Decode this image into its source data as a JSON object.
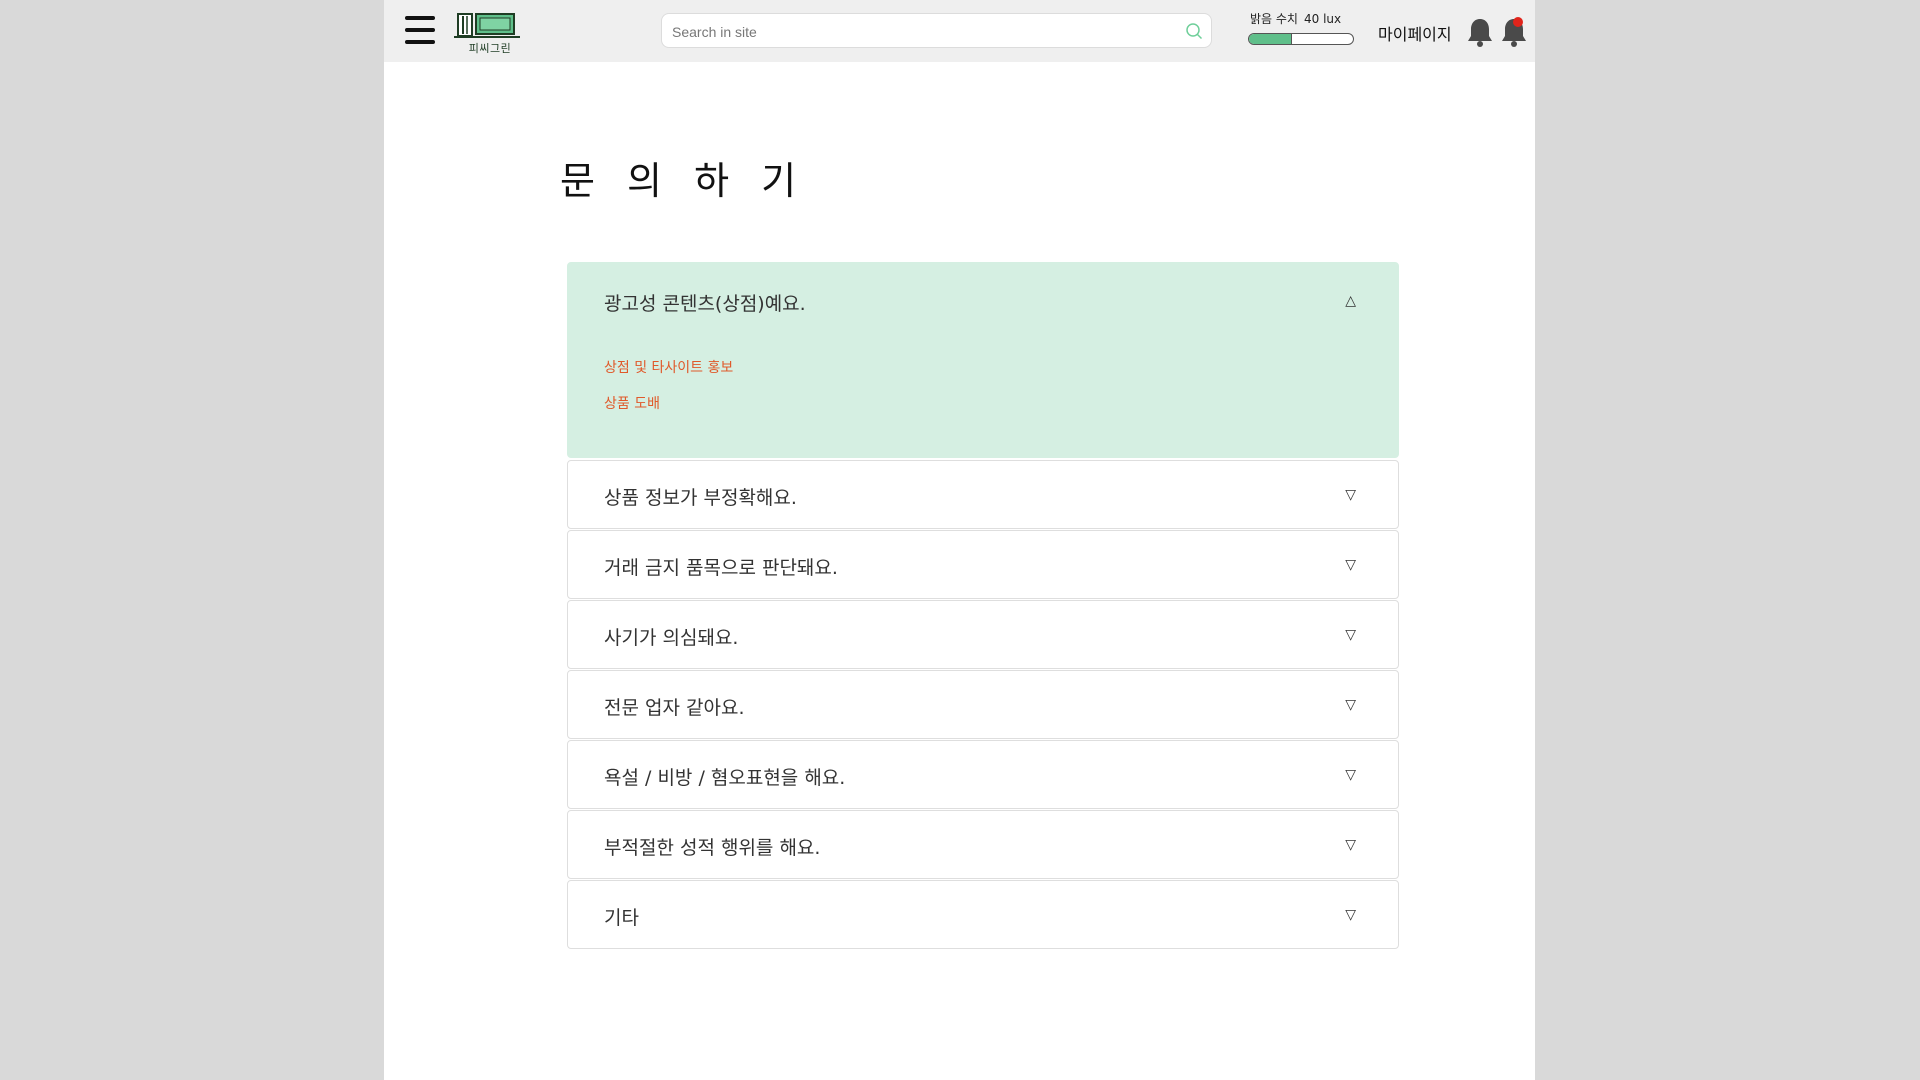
{
  "header": {
    "logo_text": "피씨그린",
    "search": {
      "placeholder": "Search in site",
      "value": ""
    },
    "brightness": {
      "label": "밝음 수치",
      "value_text": "40 lux",
      "level_percent": 40
    },
    "mypage_label": "마이페이지",
    "icons": [
      "menu-icon",
      "logo-icon",
      "search-icon",
      "bell-icon",
      "bell-alert-icon"
    ],
    "colors": {
      "bar_fill": "#5fbf8a",
      "alert_dot": "#e0241b"
    }
  },
  "page": {
    "title": "문 의 하 기"
  },
  "faq": {
    "colors": {
      "open_bg": "#d5efe2",
      "answer_text": "#e0592a"
    },
    "open_item": {
      "question": "광고성 콘텐츠(상점)예요.",
      "arrow": "△",
      "answers": [
        "상점 및 타사이트 홍보",
        "상품 도배"
      ]
    },
    "items": [
      {
        "question": "상품 정보가 부정확해요.",
        "arrow": "▽"
      },
      {
        "question": "거래 금지 품목으로 판단돼요.",
        "arrow": "▽"
      },
      {
        "question": "사기가 의심돼요.",
        "arrow": "▽"
      },
      {
        "question": "전문 업자 같아요.",
        "arrow": "▽"
      },
      {
        "question": "욕설 / 비방 / 혐오표현을 해요.",
        "arrow": "▽"
      },
      {
        "question": "부적절한 성적 행위를 해요.",
        "arrow": "▽"
      },
      {
        "question": "기타",
        "arrow": "▽"
      }
    ]
  }
}
